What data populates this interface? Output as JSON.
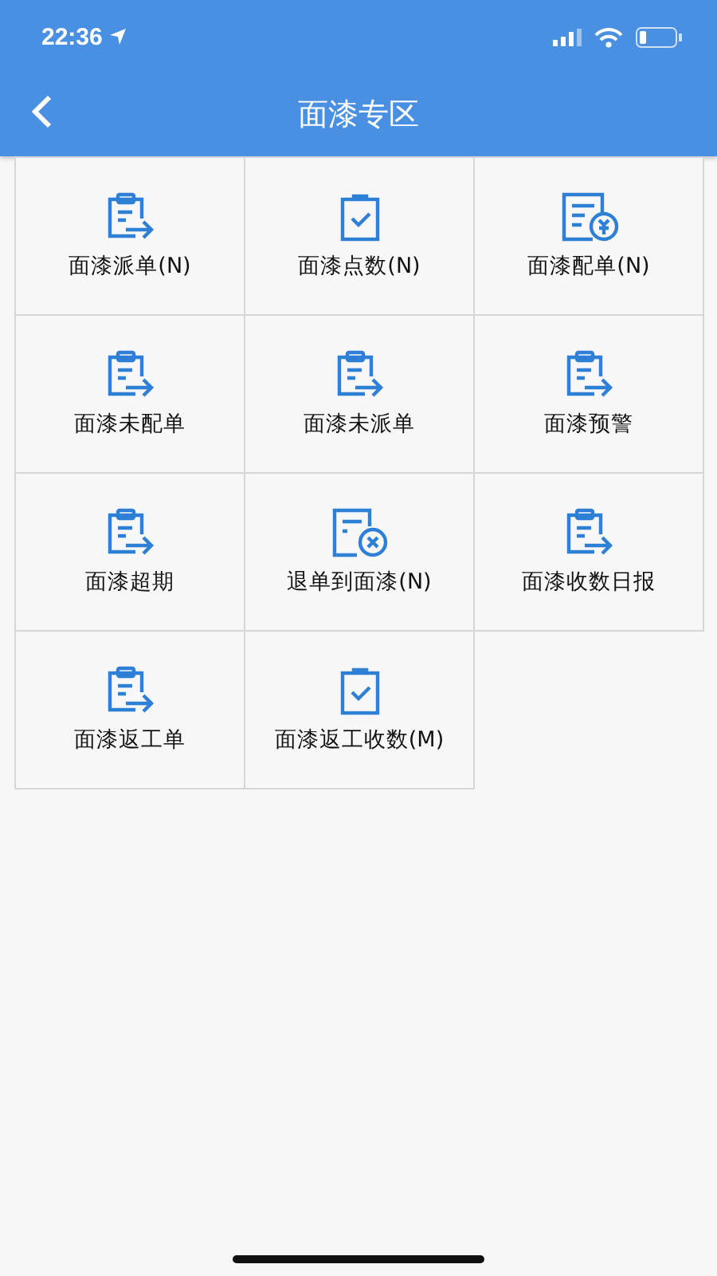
{
  "status_bar": {
    "time": "22:36"
  },
  "header": {
    "title": "面漆专区"
  },
  "menu": [
    {
      "label": "面漆派单(N)",
      "kind": "forward"
    },
    {
      "label": "面漆点数(N)",
      "kind": "check"
    },
    {
      "label": "面漆配单(N)",
      "kind": "money"
    },
    {
      "label": "面漆未配单",
      "kind": "forward"
    },
    {
      "label": "面漆未派单",
      "kind": "forward"
    },
    {
      "label": "面漆预警",
      "kind": "forward"
    },
    {
      "label": "面漆超期",
      "kind": "forward"
    },
    {
      "label": "退单到面漆(N)",
      "kind": "cancel"
    },
    {
      "label": "面漆收数日报",
      "kind": "forward"
    },
    {
      "label": "面漆返工单",
      "kind": "forward"
    },
    {
      "label": "面漆返工收数(M)",
      "kind": "check"
    }
  ]
}
